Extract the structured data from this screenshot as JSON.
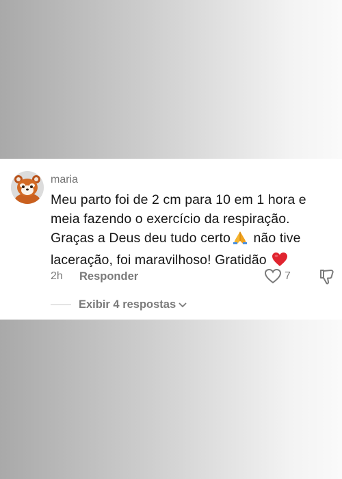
{
  "comment": {
    "username": "maria",
    "text_line1": "Meu parto foi de 2 cm para 10 em 1 hora e",
    "text_line2": "meia fazendo o exercício da respiração.",
    "text_line3a": "Graças a Deus deu tudo certo",
    "text_line3b": " não tive",
    "text_line4a": "laceração, foi maravilhoso! Gratidão ",
    "time": "2h",
    "reply_label": "Responder",
    "like_count": "7",
    "view_replies_label": "Exibir 4 respostas"
  },
  "icons": {
    "avatar": "red-panda-avatar",
    "pray": "folded-hands-emoji",
    "heart": "red-heart-emoji",
    "like": "heart-outline-icon",
    "dislike": "thumbs-down-icon",
    "expand": "chevron-down-icon"
  },
  "colors": {
    "text": "#161616",
    "muted": "#7a7a7a",
    "heart": "#e0242f"
  }
}
